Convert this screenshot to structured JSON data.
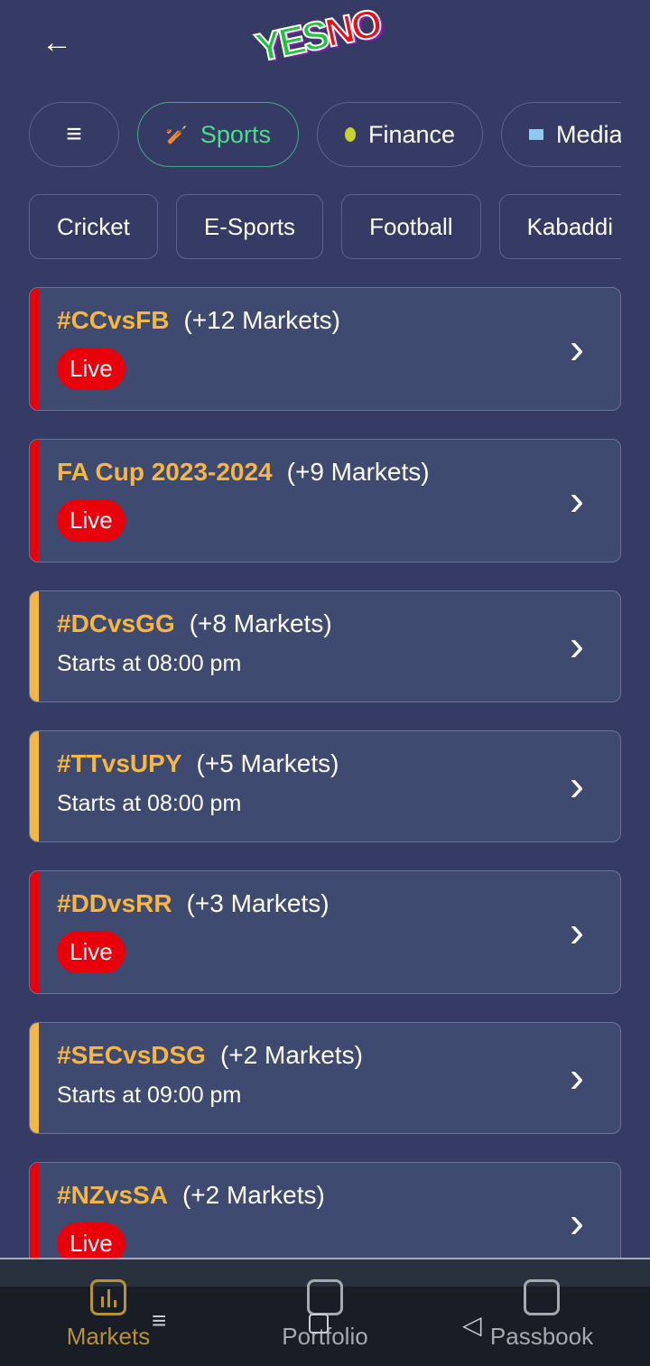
{
  "header": {
    "back_icon": "arrow-left-icon",
    "logo_text": "YESNO"
  },
  "categories": [
    {
      "label": "",
      "icon": "filter-icon"
    },
    {
      "label": "Sports",
      "icon": "cricketer-icon",
      "active": true
    },
    {
      "label": "Finance",
      "icon": "avocado-icon"
    },
    {
      "label": "Media",
      "icon": "tv-icon"
    }
  ],
  "subcategories": [
    "Cricket",
    "E-Sports",
    "Football",
    "Kabaddi"
  ],
  "events": [
    {
      "tag": "#CCvsFB",
      "markets": "(+12 Markets)",
      "status": "Live"
    },
    {
      "tag": "FA Cup 2023-2024",
      "markets": "(+9 Markets)",
      "status": "Live"
    },
    {
      "tag": "#DCvsGG",
      "markets": "(+8 Markets)",
      "status": "Starts at 08:00 pm"
    },
    {
      "tag": "#TTvsUPY",
      "markets": "(+5 Markets)",
      "status": "Starts at 08:00 pm"
    },
    {
      "tag": "#DDvsRR",
      "markets": "(+3 Markets)",
      "status": "Live"
    },
    {
      "tag": "#SECvsDSG",
      "markets": "(+2 Markets)",
      "status": "Starts at 09:00 pm"
    },
    {
      "tag": "#NZvsSA",
      "markets": "(+2 Markets)",
      "status": "Live"
    }
  ],
  "colors": {
    "live": "#e8000b",
    "upcoming": "#f5b642",
    "accent": "#4ade8a",
    "nav_active": "#b99236"
  },
  "bottom_nav": [
    {
      "label": "Markets",
      "icon": "bar-chart-icon",
      "active": true
    },
    {
      "label": "Portfolio",
      "icon": "briefcase-icon"
    },
    {
      "label": "Passbook",
      "icon": "wallet-icon"
    }
  ]
}
